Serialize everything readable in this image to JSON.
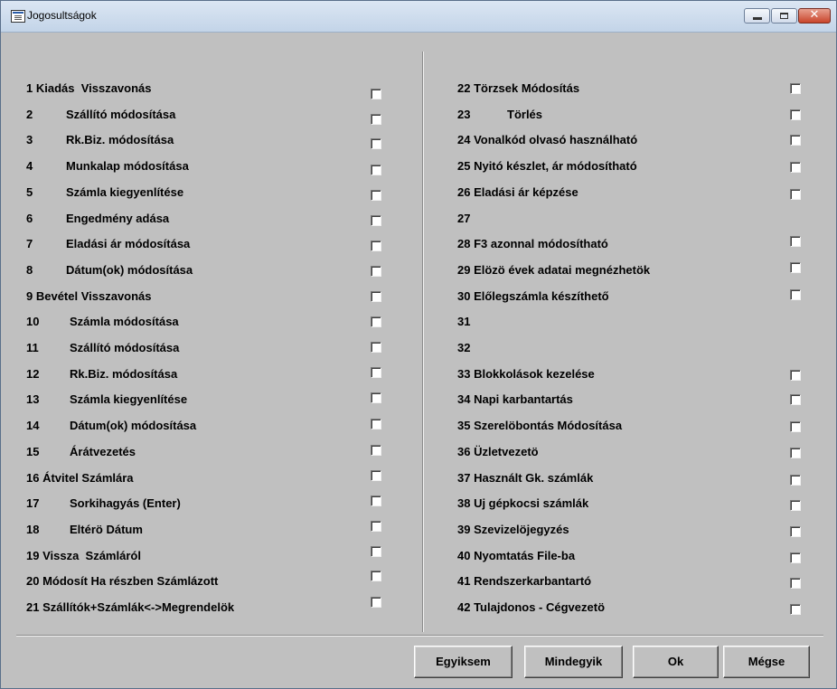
{
  "window": {
    "title": "Jogosultságok"
  },
  "left_permissions": [
    {
      "text": "1 Kiadás  Visszavonás"
    },
    {
      "num": "2",
      "label": "Szállító módosítása"
    },
    {
      "num": "3",
      "label": "Rk.Biz. módosítása"
    },
    {
      "num": "4",
      "label": "Munkalap módosítása"
    },
    {
      "num": "5",
      "label": "Számla kiegyenlítése"
    },
    {
      "num": "6",
      "label": "Engedmény adása"
    },
    {
      "num": "7",
      "label": "Eladási ár módosítása"
    },
    {
      "num": "8",
      "label": "Dátum(ok) módosítása"
    },
    {
      "text": "9 Bevétel Visszavonás"
    },
    {
      "num": "10",
      "label": "Számla módosítása"
    },
    {
      "num": "11",
      "label": "Szállító módosítása"
    },
    {
      "num": "12",
      "label": "Rk.Biz. módosítása"
    },
    {
      "num": "13",
      "label": "Számla kiegyenlítése"
    },
    {
      "num": "14",
      "label": "Dátum(ok) módosítása"
    },
    {
      "num": "15",
      "label": "Árátvezetés"
    },
    {
      "text": "16 Átvitel Számlára"
    },
    {
      "num": "17",
      "label": "Sorkihagyás (Enter)"
    },
    {
      "num": "18",
      "label": "Eltérö Dátum"
    },
    {
      "text": "19 Vissza  Számláról"
    },
    {
      "text": "20 Módosít Ha részben Számlázott"
    },
    {
      "text": "21 Szállítók+Számlák<->Megrendelök"
    }
  ],
  "right_permissions": [
    {
      "text": "22 Törzsek Módosítás"
    },
    {
      "num": "23",
      "label": "Törlés"
    },
    {
      "text": "24 Vonalkód olvasó használható"
    },
    {
      "text": "25 Nyitó készlet, ár módosítható"
    },
    {
      "text": "26 Eladási ár képzése"
    },
    {
      "text": "27"
    },
    {
      "text": "28 F3 azonnal módosítható"
    },
    {
      "text": "29 Elözö évek adatai megnézhetök"
    },
    {
      "text": "30 Előlegszámla készíthető"
    },
    {
      "text": "31"
    },
    {
      "text": "32"
    },
    {
      "text": "33 Blokkolások kezelése"
    },
    {
      "text": "34 Napi karbantartás"
    },
    {
      "text": "35 Szerelöbontás Módosítása"
    },
    {
      "text": "36 Üzletvezetö"
    },
    {
      "text": "37 Használt Gk. számlák"
    },
    {
      "text": "38 Uj gépkocsi számlák"
    },
    {
      "text": "39 Szevizelöjegyzés"
    },
    {
      "text": "40 Nyomtatás File-ba"
    },
    {
      "text": "41 Rendszerkarbantartó"
    },
    {
      "text": "42 Tulajdonos - Cégvezetö"
    }
  ],
  "right_checkbox_visible": [
    true,
    true,
    true,
    true,
    true,
    false,
    true,
    true,
    true,
    false,
    false,
    true,
    true,
    true,
    true,
    true,
    true,
    true,
    true,
    true,
    true
  ],
  "buttons": {
    "none": "Egyiksem",
    "all": "Mindegyik",
    "ok": "Ok",
    "cancel": "Mégse"
  }
}
